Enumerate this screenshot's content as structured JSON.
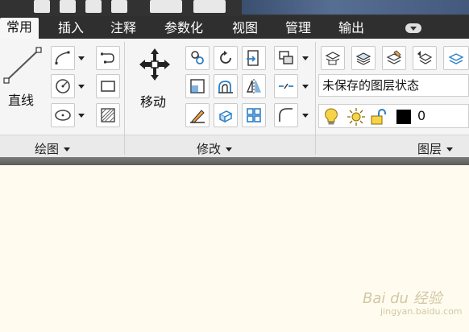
{
  "tabs": [
    {
      "label": "常用",
      "active": true
    },
    {
      "label": "插入"
    },
    {
      "label": "注释"
    },
    {
      "label": "参数化"
    },
    {
      "label": "视图"
    },
    {
      "label": "管理"
    },
    {
      "label": "输出"
    }
  ],
  "draw_panel": {
    "line_label": "直线",
    "title": "绘图"
  },
  "modify_panel": {
    "move_label": "移动",
    "title": "修改"
  },
  "layers_panel": {
    "state_value": "未保存的图层状态",
    "current_layer": "0",
    "title": "图层"
  },
  "watermark": {
    "text": "Bai du 经验",
    "sub": "jingyan.baidu.com"
  },
  "colors": {
    "tab_bar": "#2f2f2f",
    "ribbon": "#f5f5f5",
    "canvas": "#fffcef",
    "icon_blue": "#2b7fc8"
  }
}
